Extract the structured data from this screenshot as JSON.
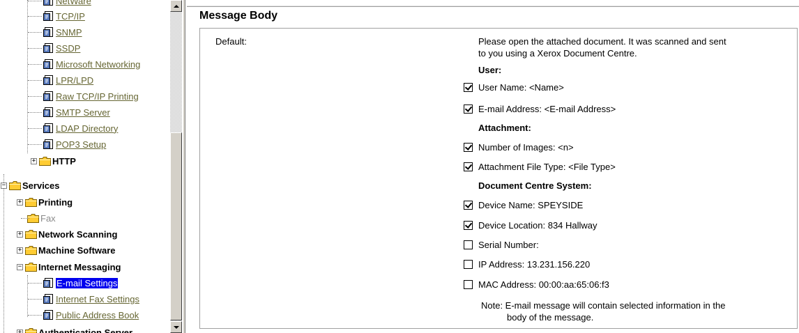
{
  "tree": {
    "top_partial": "NetWare",
    "protocol_items": [
      "TCP/IP",
      "SNMP",
      "SSDP",
      "Microsoft Networking",
      "LPR/LPD",
      "Raw TCP/IP Printing",
      "SMTP Server",
      "LDAP Directory",
      "POP3 Setup"
    ],
    "http": "HTTP",
    "services": "Services",
    "printing": "Printing",
    "fax": "Fax",
    "network_scanning": "Network Scanning",
    "machine_software": "Machine Software",
    "internet_messaging": "Internet Messaging",
    "email_settings": "E-mail Settings",
    "internet_fax_settings": "Internet Fax Settings",
    "public_address_book": "Public Address Book",
    "authentication_server": "Authentication Server"
  },
  "content": {
    "section_title": "Message Body",
    "default_label": "Default:",
    "default_text_line1": "Please open the attached document. It was scanned and sent",
    "default_text_line2": "to you using a Xerox Document Centre.",
    "user_heading": "User:",
    "user_name": {
      "label": "User Name: <Name>",
      "checked": true
    },
    "email_address": {
      "label": "E-mail Address: <E-mail Address>",
      "checked": true
    },
    "attachment_heading": "Attachment:",
    "number_of_images": {
      "label": "Number of Images: <n>",
      "checked": true
    },
    "attachment_file_type": {
      "label": "Attachment File Type: <File Type>",
      "checked": true
    },
    "system_heading": "Document Centre System:",
    "device_name": {
      "label": "Device Name: SPEYSIDE",
      "checked": true
    },
    "device_location": {
      "label": "Device Location: 834 Hallway",
      "checked": true
    },
    "serial_number": {
      "label": "Serial Number:",
      "checked": false
    },
    "ip_address": {
      "label": "IP Address: 13.231.156.220",
      "checked": false
    },
    "mac_address": {
      "label": "MAC Address: 00:00:aa:65:06:f3",
      "checked": false
    },
    "note_line1": "Note: E-mail message will contain selected information in the",
    "note_line2": "body of the message."
  },
  "colors": {
    "link": "#666633",
    "selected_bg": "#0000ee",
    "folder": "#ffcc33"
  },
  "icons": {
    "doc": "document-page-icon",
    "folder": "folder-icon",
    "expand": "plus-box",
    "collapse": "minus-box"
  }
}
